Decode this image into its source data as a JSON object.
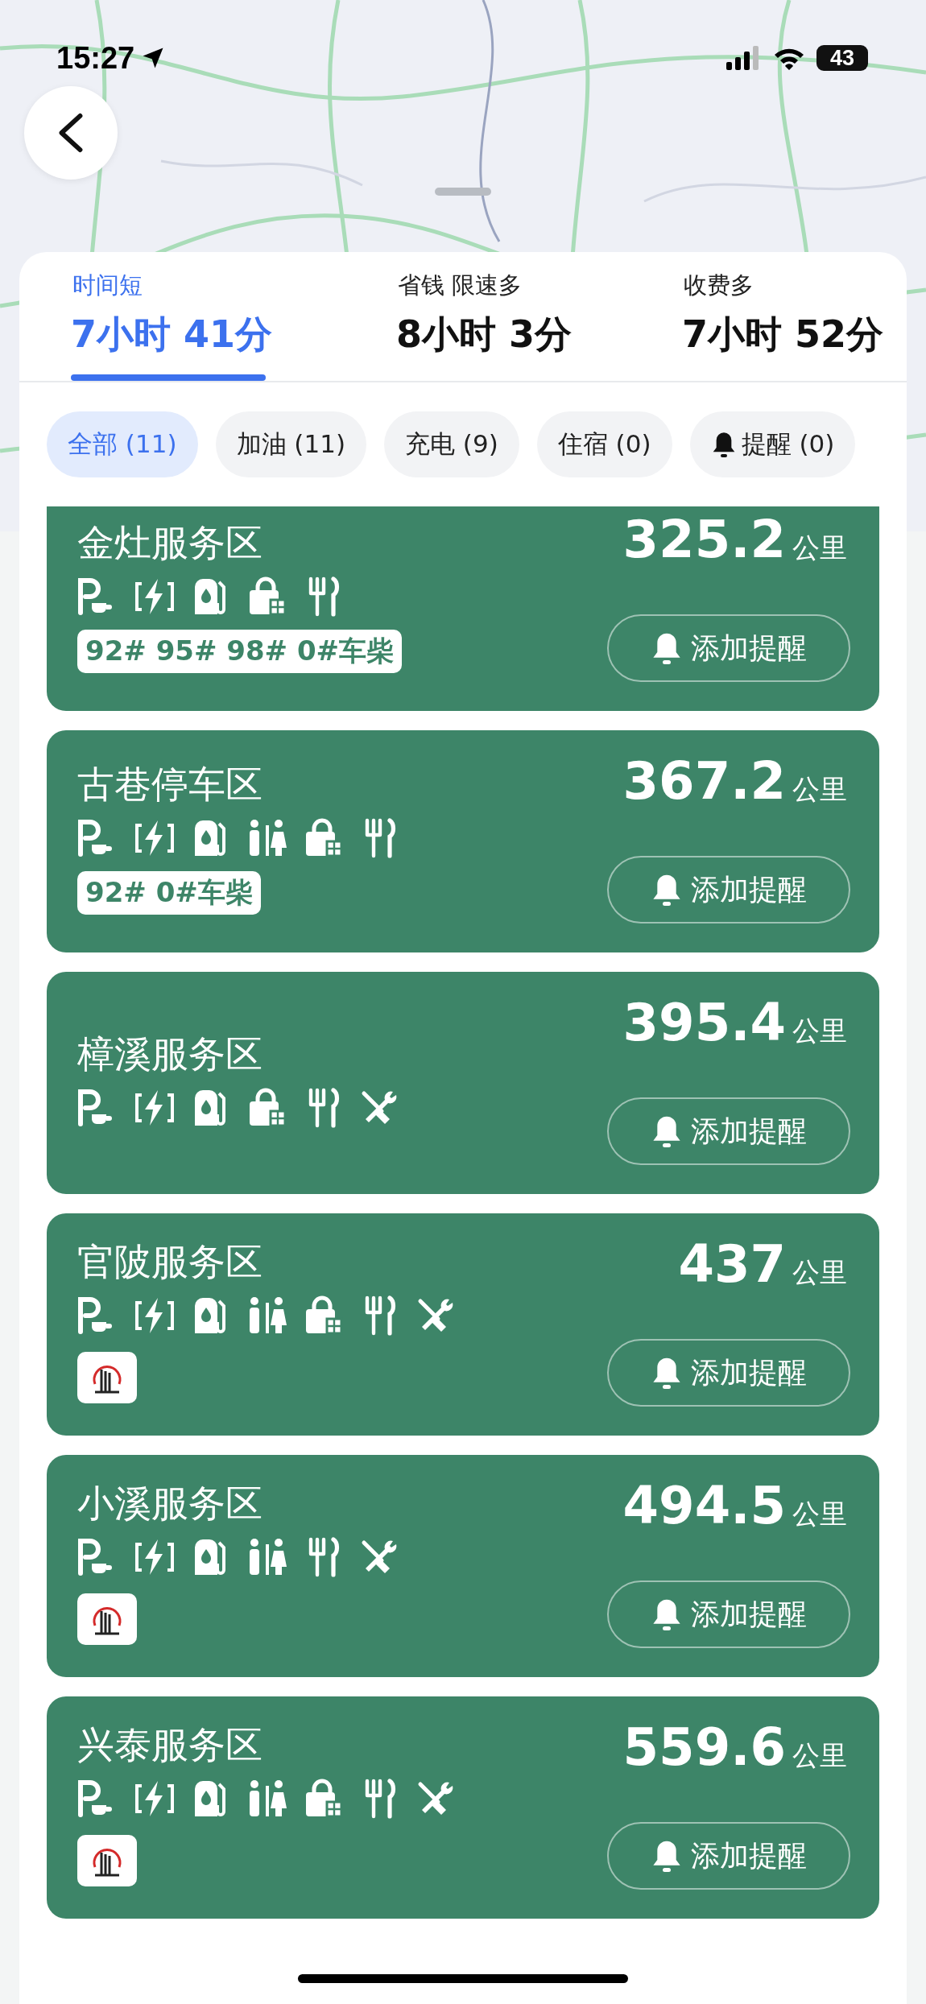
{
  "status_bar": {
    "time": "15:27",
    "battery": "43"
  },
  "route_tabs": [
    {
      "label": "时间短",
      "duration": "7小时 41分",
      "selected": true
    },
    {
      "label": "省钱 限速多",
      "duration": "8小时 3分",
      "selected": false
    },
    {
      "label": "收费多",
      "duration": "7小时 52分",
      "selected": false
    }
  ],
  "filters": [
    {
      "kind": "plain",
      "label": "全部 (11)",
      "selected": true
    },
    {
      "kind": "plain",
      "label": "加油 (11)",
      "selected": false
    },
    {
      "kind": "plain",
      "label": "充电 (9)",
      "selected": false
    },
    {
      "kind": "plain",
      "label": "住宿 (0)",
      "selected": false
    },
    {
      "kind": "reminder",
      "label": "提醒 (0)",
      "selected": false
    }
  ],
  "service_areas": [
    {
      "name": "金灶服务区",
      "distance": "325.2",
      "unit": "公里",
      "facilities": [
        {
          "kind": "parking"
        },
        {
          "kind": "charging"
        },
        {
          "kind": "fuel"
        },
        {
          "kind": "shop"
        },
        {
          "kind": "food"
        }
      ],
      "extra": {
        "kind": "tag",
        "text": "92# 95# 98# 0#车柴"
      },
      "button": "添加提醒"
    },
    {
      "name": "古巷停车区",
      "distance": "367.2",
      "unit": "公里",
      "facilities": [
        {
          "kind": "parking"
        },
        {
          "kind": "charging"
        },
        {
          "kind": "fuel"
        },
        {
          "kind": "restroom"
        },
        {
          "kind": "shop"
        },
        {
          "kind": "food"
        }
      ],
      "extra": {
        "kind": "tag",
        "text": "92# 0#车柴"
      },
      "button": "添加提醒"
    },
    {
      "name": "樟溪服务区",
      "distance": "395.4",
      "unit": "公里",
      "facilities": [
        {
          "kind": "parking"
        },
        {
          "kind": "charging"
        },
        {
          "kind": "fuel"
        },
        {
          "kind": "shop"
        },
        {
          "kind": "food"
        },
        {
          "kind": "repair"
        }
      ],
      "button": "添加提醒"
    },
    {
      "name": "官陂服务区",
      "distance": "437",
      "unit": "公里",
      "facilities": [
        {
          "kind": "parking"
        },
        {
          "kind": "charging"
        },
        {
          "kind": "fuel"
        },
        {
          "kind": "restroom"
        },
        {
          "kind": "shop"
        },
        {
          "kind": "food"
        },
        {
          "kind": "repair"
        }
      ],
      "extra": {
        "kind": "logo"
      },
      "button": "添加提醒"
    },
    {
      "name": "小溪服务区",
      "distance": "494.5",
      "unit": "公里",
      "facilities": [
        {
          "kind": "parking"
        },
        {
          "kind": "charging"
        },
        {
          "kind": "fuel"
        },
        {
          "kind": "restroom"
        },
        {
          "kind": "food"
        },
        {
          "kind": "repair"
        }
      ],
      "extra": {
        "kind": "logo"
      },
      "button": "添加提醒"
    },
    {
      "name": "兴泰服务区",
      "distance": "559.6",
      "unit": "公里",
      "facilities": [
        {
          "kind": "parking"
        },
        {
          "kind": "charging"
        },
        {
          "kind": "fuel"
        },
        {
          "kind": "restroom"
        },
        {
          "kind": "shop"
        },
        {
          "kind": "food"
        },
        {
          "kind": "repair"
        }
      ],
      "extra": {
        "kind": "logo"
      },
      "button": "添加提醒"
    }
  ]
}
